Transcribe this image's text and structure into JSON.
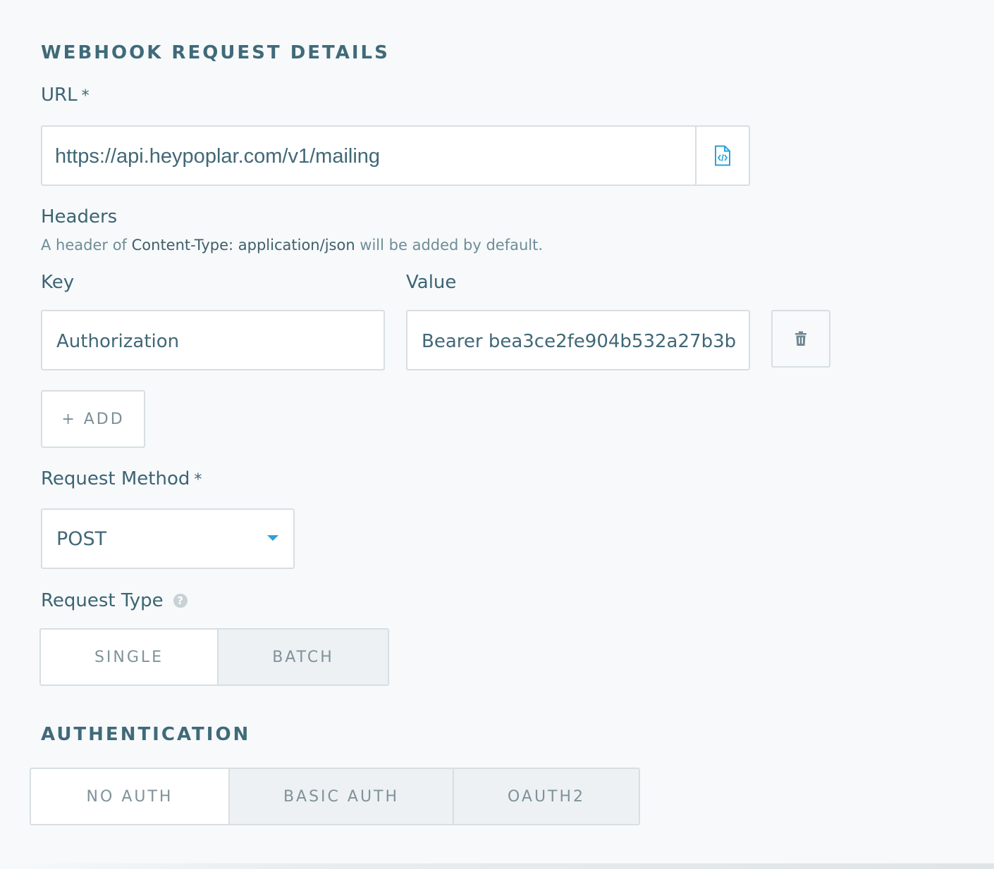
{
  "webhook": {
    "section_title": "WEBHOOK REQUEST DETAILS",
    "url_label": "URL",
    "required_mark": "*",
    "url_value": "https://api.heypoplar.com/v1/mailing",
    "url_icon": "code-file-icon"
  },
  "headers": {
    "label": "Headers",
    "hint_prefix": "A header of ",
    "hint_emphasis": "Content-Type: application/json",
    "hint_suffix": " will be added by default.",
    "key_label": "Key",
    "value_label": "Value",
    "rows": [
      {
        "key": "Authorization",
        "value": "Bearer  bea3ce2fe904b532a27b3b"
      }
    ],
    "delete_icon": "trash-icon",
    "add_label": "+ ADD"
  },
  "request_method": {
    "label": "Request Method",
    "required_mark": "*",
    "selected": "POST"
  },
  "request_type": {
    "label": "Request Type",
    "help_icon": "question-circle-icon",
    "help_glyph": "?",
    "options": [
      "SINGLE",
      "BATCH"
    ],
    "selected": "SINGLE"
  },
  "authentication": {
    "section_title": "AUTHENTICATION",
    "options": [
      "NO AUTH",
      "BASIC AUTH",
      "OAUTH2"
    ],
    "selected": "NO AUTH"
  },
  "colors": {
    "accent": "#2aa3d6",
    "heading": "#3f6a79",
    "border": "#d7dfe3",
    "background": "#f7f9fb"
  }
}
